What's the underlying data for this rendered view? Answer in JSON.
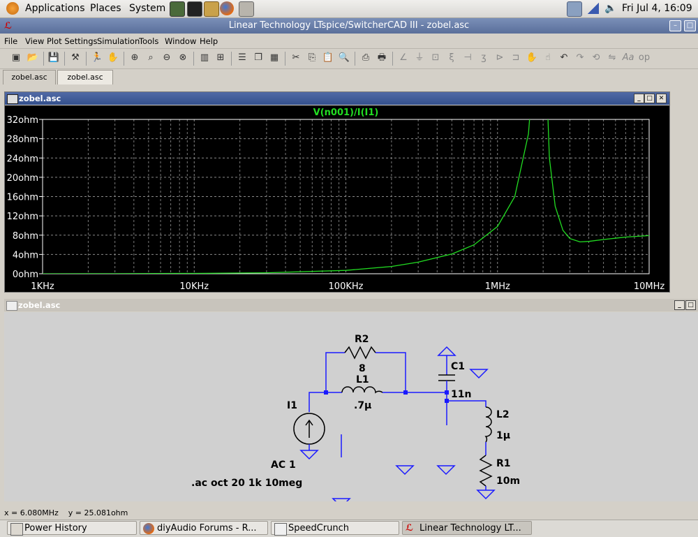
{
  "panel": {
    "menus": [
      "Applications",
      "Places",
      "System"
    ],
    "clock": "Fri Jul  4, 16:09"
  },
  "window": {
    "title": "Linear Technology LTspice/SwitcherCAD III - zobel.asc"
  },
  "menubar": [
    "File",
    "View",
    "Plot Settings",
    "Simulation",
    "Tools",
    "Window",
    "Help"
  ],
  "tabs": [
    "zobel.asc",
    "zobel.asc"
  ],
  "plot_window": {
    "title": "zobel.asc",
    "trace_label": "V(n001)/I(I1)",
    "trace_color": "#22dd22"
  },
  "chart_data": {
    "type": "line",
    "title": "V(n001)/I(I1)",
    "x_scale": "log",
    "xlim": [
      1000,
      10000000
    ],
    "x_ticks": [
      "1KHz",
      "10KHz",
      "100KHz",
      "1MHz",
      "10MHz"
    ],
    "ylim": [
      0,
      32
    ],
    "y_ticks": [
      "32ohm",
      "28ohm",
      "24ohm",
      "20ohm",
      "16ohm",
      "12ohm",
      "8ohm",
      "4ohm",
      "0ohm"
    ],
    "grid": true,
    "series": [
      {
        "name": "V(n001)/I(I1)",
        "x": [
          1000,
          3000,
          10000,
          30000,
          100000,
          200000,
          300000,
          500000,
          700000,
          1000000,
          1300000,
          1600000,
          1800000,
          1900000,
          2000000,
          2200000,
          2400000,
          2700000,
          3000000,
          3500000,
          4000000,
          5000000,
          7000000,
          10000000
        ],
        "y": [
          0.0,
          0.02,
          0.07,
          0.2,
          0.7,
          1.5,
          2.4,
          4.1,
          6.0,
          9.8,
          16.0,
          29.0,
          50.0,
          150.0,
          60.0,
          24.0,
          14.0,
          9.0,
          7.3,
          6.6,
          6.7,
          7.1,
          7.6,
          7.9
        ]
      }
    ]
  },
  "schematic_window": {
    "title": "zobel.asc"
  },
  "schematic": {
    "r2_name": "R2",
    "r2_value": "8",
    "l1_name": "L1",
    "l1_value": ".7µ",
    "c1_name": "C1",
    "c1_value": "11n",
    "l2_name": "L2",
    "l2_value": "1µ",
    "r1_name": "R1",
    "r1_value": "10m",
    "i1_name": "I1",
    "i1_value": "AC 1",
    "directive": ".ac oct 20 1k 10meg"
  },
  "status": {
    "cursor": "x = 6.080MHz    y = 25.081ohm"
  },
  "taskbar": [
    "Power History",
    "diyAudio Forums - R...",
    "SpeedCrunch",
    "Linear Technology LT..."
  ]
}
